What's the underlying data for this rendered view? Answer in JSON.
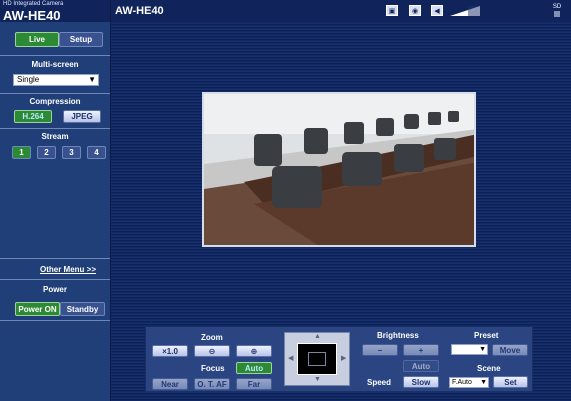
{
  "brand": {
    "small_text": "HD Integrated Camera",
    "model": "AW-HE40"
  },
  "camera_title": "AW-HE40",
  "header_icons": [
    "snapshot-icon",
    "camera-icon",
    "speaker-icon",
    "signal-level-icon"
  ],
  "sd_label": "SD",
  "tabs": {
    "live": "Live",
    "setup": "Setup"
  },
  "multi_screen": {
    "title": "Multi-screen",
    "selected": "Single"
  },
  "compression": {
    "title": "Compression",
    "h264": "H.264",
    "jpeg": "JPEG"
  },
  "stream": {
    "title": "Stream",
    "buttons": [
      "1",
      "2",
      "3",
      "4"
    ],
    "active": "1"
  },
  "other_menu": "Other Menu >>",
  "power": {
    "title": "Power",
    "on": "Power ON",
    "standby": "Standby"
  },
  "zoom": {
    "title": "Zoom",
    "reset": "×1.0",
    "out_icon": "zoom-out-icon",
    "in_icon": "zoom-in-icon"
  },
  "focus": {
    "title": "Focus",
    "auto": "Auto",
    "near": "Near",
    "ot_af": "O. T. AF",
    "far": "Far"
  },
  "brightness": {
    "title": "Brightness",
    "minus": "−",
    "plus": "+",
    "auto": "Auto"
  },
  "speed": {
    "title": "Speed",
    "value": "Slow"
  },
  "preset": {
    "title": "Preset",
    "selected": "",
    "move": "Move"
  },
  "scene": {
    "title": "Scene",
    "selected": "F.Auto",
    "set": "Set"
  },
  "colors": {
    "sidebar": "#203e77",
    "active_green": "#2c8a34",
    "header": "#10245b"
  }
}
